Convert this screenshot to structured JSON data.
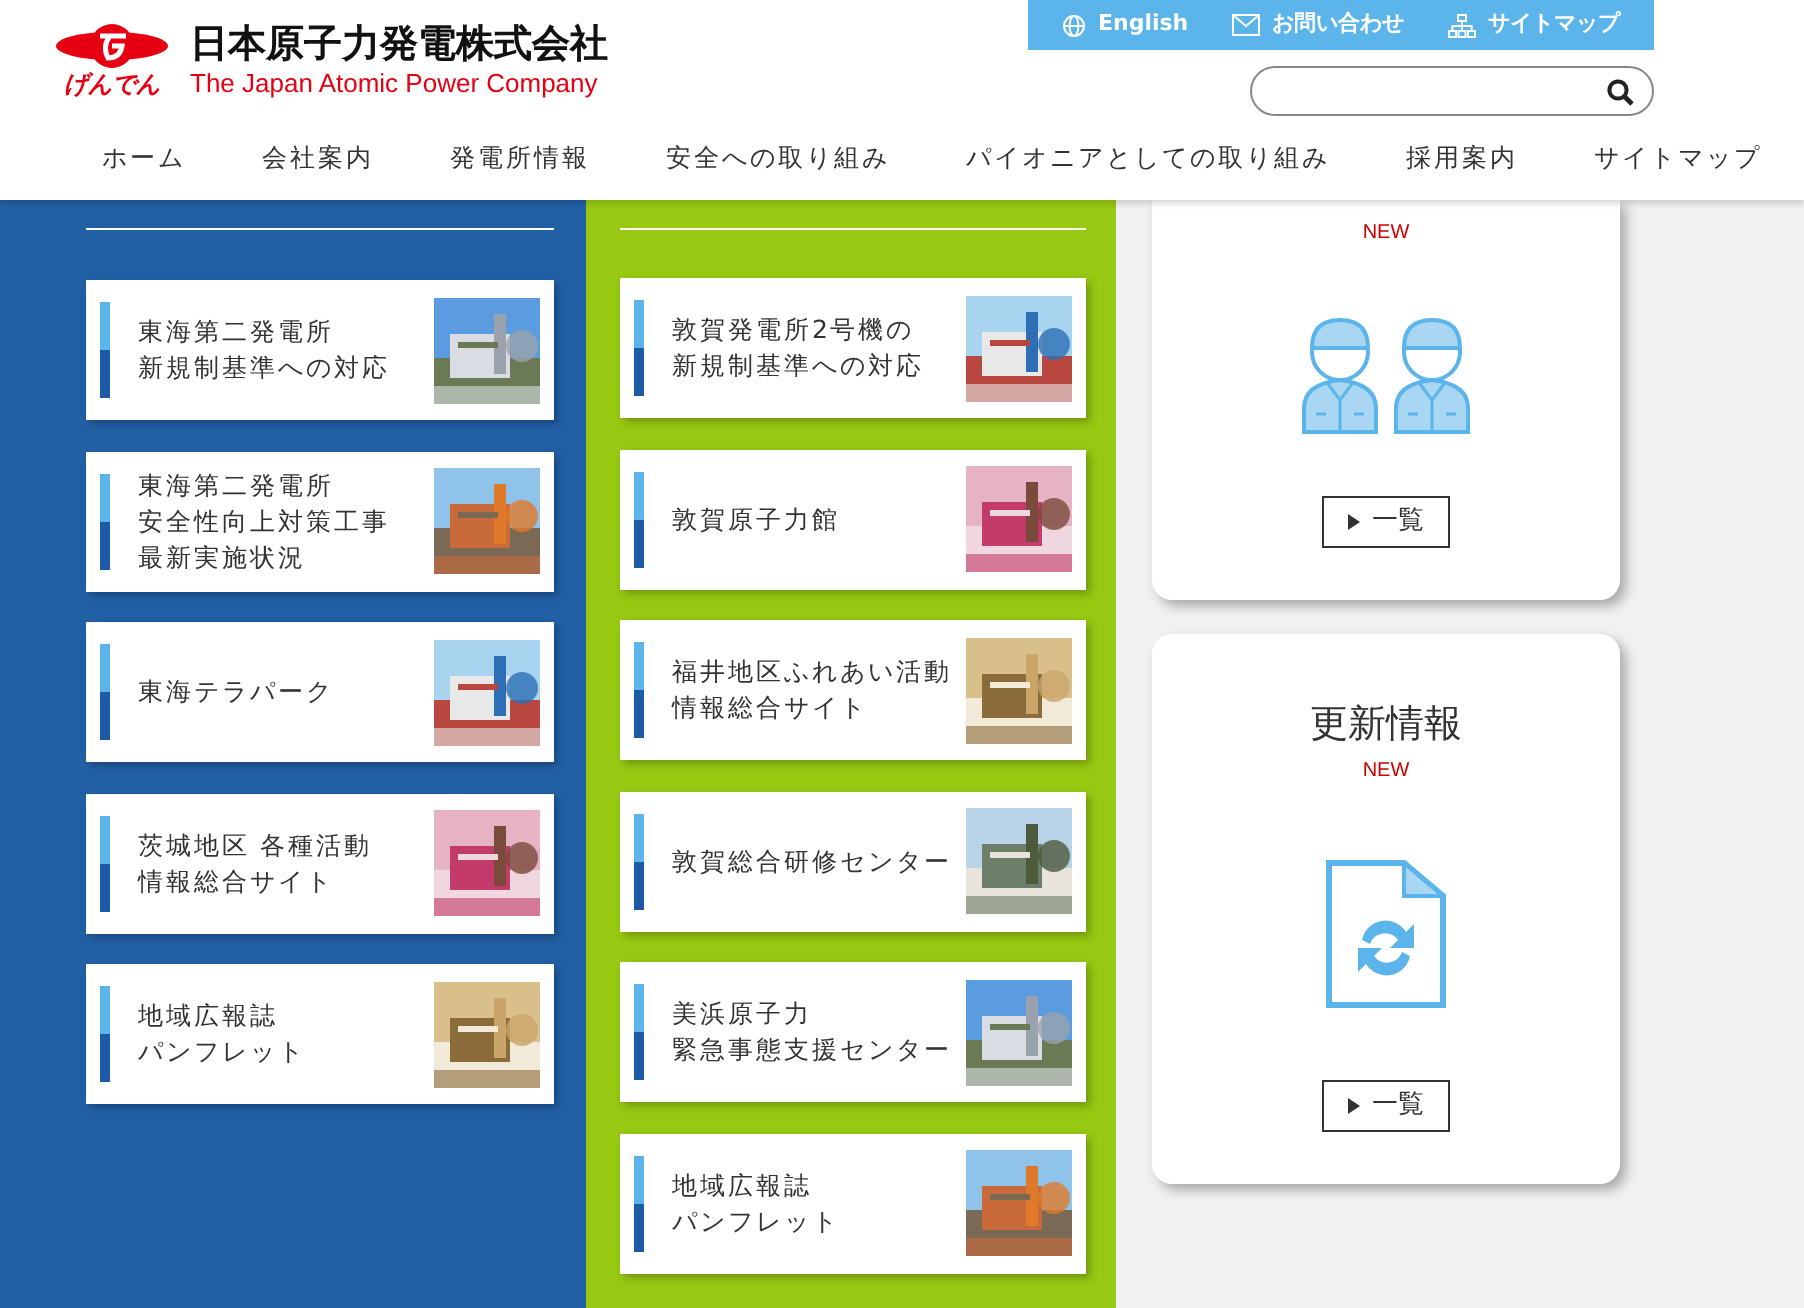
{
  "header": {
    "logo_text": "げんでん",
    "company_name": "日本原子力発電株式会社",
    "company_name_en": "The Japan Atomic Power Company",
    "utility_links": [
      {
        "label": "English",
        "kind": "globe"
      },
      {
        "label": "お問い合わせ",
        "kind": "mail"
      },
      {
        "label": "サイトマップ",
        "kind": "sitemap"
      }
    ],
    "nav": [
      "ホーム",
      "会社案内",
      "発電所情報",
      "安全への取り組み",
      "パイオニアとしての取り組み",
      "採用案内",
      "サイトマップ"
    ]
  },
  "left_column": {
    "cards": [
      {
        "lines": [
          "東海第二発電所",
          "新規制基準への対応"
        ]
      },
      {
        "lines": [
          "東海第二発電所",
          "安全性向上対策工事",
          "最新実施状況"
        ]
      },
      {
        "lines": [
          "東海テラパーク"
        ]
      },
      {
        "lines": [
          "茨城地区 各種活動",
          "情報総合サイト"
        ]
      },
      {
        "lines": [
          "地域広報誌",
          "パンフレット"
        ]
      }
    ]
  },
  "middle_column": {
    "cards": [
      {
        "lines": [
          "敦賀発電所2号機の",
          "新規制基準への対応"
        ]
      },
      {
        "lines": [
          "敦賀原子力館"
        ]
      },
      {
        "lines": [
          "福井地区ふれあい活動",
          "情報総合サイト"
        ]
      },
      {
        "lines": [
          "敦賀総合研修センター"
        ]
      },
      {
        "lines": [
          "美浜原子力",
          "緊急事態支援センター"
        ]
      },
      {
        "lines": [
          "地域広報誌",
          "パンフレット"
        ]
      }
    ]
  },
  "right_column": {
    "cards": [
      {
        "kind": "workers",
        "badge": "NEW",
        "button": "一覧"
      },
      {
        "kind": "document",
        "title": "更新情報",
        "badge": "NEW",
        "button": "一覧"
      }
    ]
  }
}
